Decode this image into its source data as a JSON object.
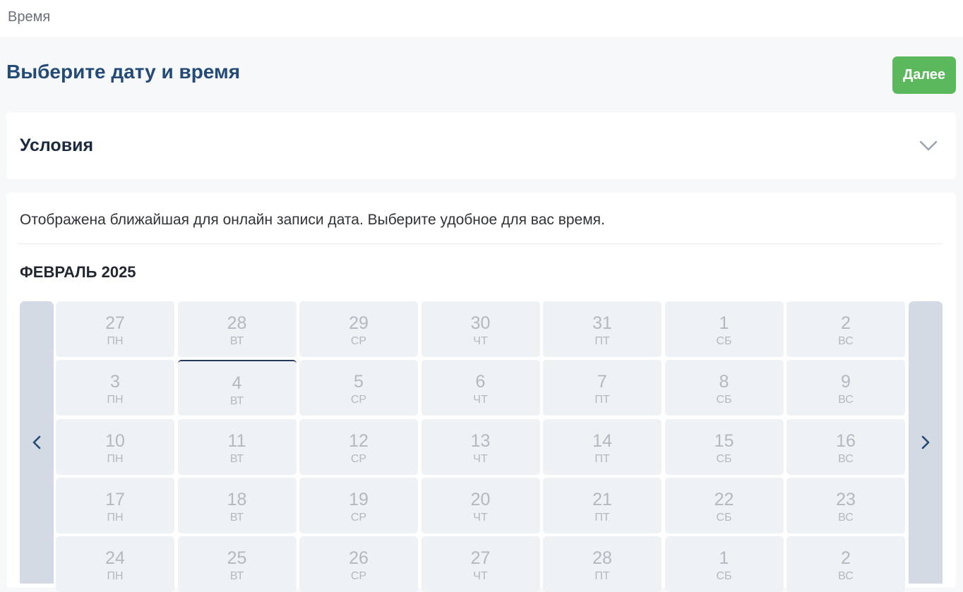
{
  "topbar": {
    "crumb": "Время"
  },
  "header": {
    "title": "Выберите дату и время",
    "next_label": "Далее"
  },
  "conditions": {
    "label": "Условия"
  },
  "calendar": {
    "info": "Отображена ближайшая для онлайн записи дата. Выберите удобное для вас время.",
    "month": "ФЕВРАЛЬ 2025",
    "selected": "4",
    "rows": [
      [
        {
          "n": "27",
          "d": "ПН"
        },
        {
          "n": "28",
          "d": "ВТ"
        },
        {
          "n": "29",
          "d": "СР"
        },
        {
          "n": "30",
          "d": "ЧТ"
        },
        {
          "n": "31",
          "d": "ПТ"
        },
        {
          "n": "1",
          "d": "СБ"
        },
        {
          "n": "2",
          "d": "ВС"
        }
      ],
      [
        {
          "n": "3",
          "d": "ПН"
        },
        {
          "n": "4",
          "d": "ВТ"
        },
        {
          "n": "5",
          "d": "СР"
        },
        {
          "n": "6",
          "d": "ЧТ"
        },
        {
          "n": "7",
          "d": "ПТ"
        },
        {
          "n": "8",
          "d": "СБ"
        },
        {
          "n": "9",
          "d": "ВС"
        }
      ],
      [
        {
          "n": "10",
          "d": "ПН"
        },
        {
          "n": "11",
          "d": "ВТ"
        },
        {
          "n": "12",
          "d": "СР"
        },
        {
          "n": "13",
          "d": "ЧТ"
        },
        {
          "n": "14",
          "d": "ПТ"
        },
        {
          "n": "15",
          "d": "СБ"
        },
        {
          "n": "16",
          "d": "ВС"
        }
      ],
      [
        {
          "n": "17",
          "d": "ПН"
        },
        {
          "n": "18",
          "d": "ВТ"
        },
        {
          "n": "19",
          "d": "СР"
        },
        {
          "n": "20",
          "d": "ЧТ"
        },
        {
          "n": "21",
          "d": "ПТ"
        },
        {
          "n": "22",
          "d": "СБ"
        },
        {
          "n": "23",
          "d": "ВС"
        }
      ],
      [
        {
          "n": "24",
          "d": "ПН"
        },
        {
          "n": "25",
          "d": "ВТ"
        },
        {
          "n": "26",
          "d": "СР"
        },
        {
          "n": "27",
          "d": "ЧТ"
        },
        {
          "n": "28",
          "d": "ПТ"
        },
        {
          "n": "1",
          "d": "СБ"
        },
        {
          "n": "2",
          "d": "ВС"
        }
      ]
    ]
  },
  "colors": {
    "accent": "#244b78",
    "button": "#5cb85c",
    "cell": "#eff2f5",
    "nav": "#d3dae3"
  },
  "icons": {
    "prev": "chevron-left-icon",
    "next": "chevron-right-icon",
    "expand": "chevron-down-icon"
  }
}
